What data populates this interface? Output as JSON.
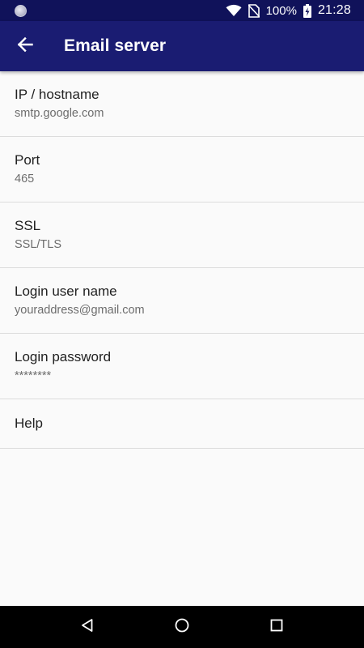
{
  "status_bar": {
    "battery_percent": "100%",
    "time": "21:28"
  },
  "app_bar": {
    "title": "Email server"
  },
  "settings": [
    {
      "title": "IP / hostname",
      "summary": "smtp.google.com"
    },
    {
      "title": "Port",
      "summary": "465"
    },
    {
      "title": "SSL",
      "summary": "SSL/TLS"
    },
    {
      "title": "Login user name",
      "summary": "youraddress@gmail.com"
    },
    {
      "title": "Login password",
      "summary": "********"
    },
    {
      "title": "Help"
    }
  ],
  "colors": {
    "app_bar": "#1a1c72",
    "status_bar": "#10125a",
    "background": "#fafafa",
    "nav_bar": "#000000"
  },
  "icons": {
    "back": "arrow-back-icon",
    "wifi": "wifi-icon",
    "no_sim": "no-sim-icon",
    "battery": "battery-charging-icon",
    "nav_back": "triangle-back-icon",
    "nav_home": "circle-home-icon",
    "nav_recents": "square-recents-icon"
  }
}
